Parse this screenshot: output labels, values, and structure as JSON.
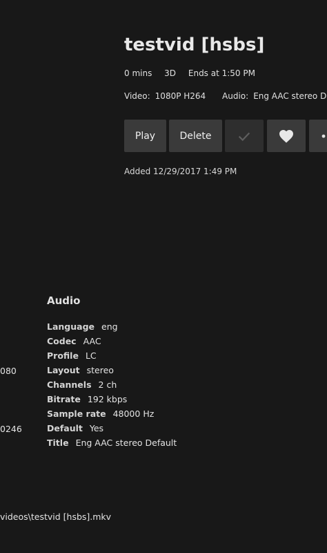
{
  "item": {
    "title": "testvid [hsbs]",
    "duration": "0 mins",
    "format_3d": "3D",
    "ends_at": "Ends at 1:50 PM"
  },
  "streams": {
    "video_label": "Video:",
    "video_value": "1080P H264",
    "audio_label": "Audio:",
    "audio_value": "Eng AAC stereo Default"
  },
  "actions": {
    "play_label": "Play",
    "delete_label": "Delete",
    "played_icon": "check-icon",
    "favorite_icon": "heart-icon",
    "more_icon": "more-icon"
  },
  "added": "Added 12/29/2017 1:49 PM",
  "audio": {
    "heading": "Audio",
    "rows": [
      {
        "key": "Language",
        "value": "eng"
      },
      {
        "key": "Codec",
        "value": "AAC"
      },
      {
        "key": "Profile",
        "value": "LC"
      },
      {
        "key": "Layout",
        "value": "stereo"
      },
      {
        "key": "Channels",
        "value": "2 ch"
      },
      {
        "key": "Bitrate",
        "value": "192 kbps"
      },
      {
        "key": "Sample rate",
        "value": "48000 Hz"
      },
      {
        "key": "Default",
        "value": "Yes"
      },
      {
        "key": "Title",
        "value": "Eng AAC stereo Default"
      }
    ]
  },
  "video_fragments": {
    "layout_value_cut": "080",
    "default_value_cut": "0246"
  },
  "file_path": "videos\\testvid [hsbs].mkv"
}
